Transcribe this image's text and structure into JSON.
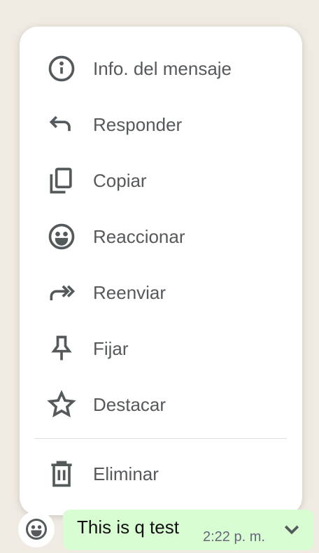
{
  "menu": {
    "items": [
      {
        "label": "Info. del mensaje",
        "icon": "info-icon"
      },
      {
        "label": "Responder",
        "icon": "reply-icon"
      },
      {
        "label": "Copiar",
        "icon": "copy-icon"
      },
      {
        "label": "Reaccionar",
        "icon": "emoji-icon"
      },
      {
        "label": "Reenviar",
        "icon": "forward-icon"
      },
      {
        "label": "Fijar",
        "icon": "pin-icon"
      },
      {
        "label": "Destacar",
        "icon": "star-icon"
      },
      {
        "label": "Eliminar",
        "icon": "trash-icon"
      }
    ]
  },
  "message": {
    "text": "This is q test",
    "time": "2:22 p. m."
  }
}
